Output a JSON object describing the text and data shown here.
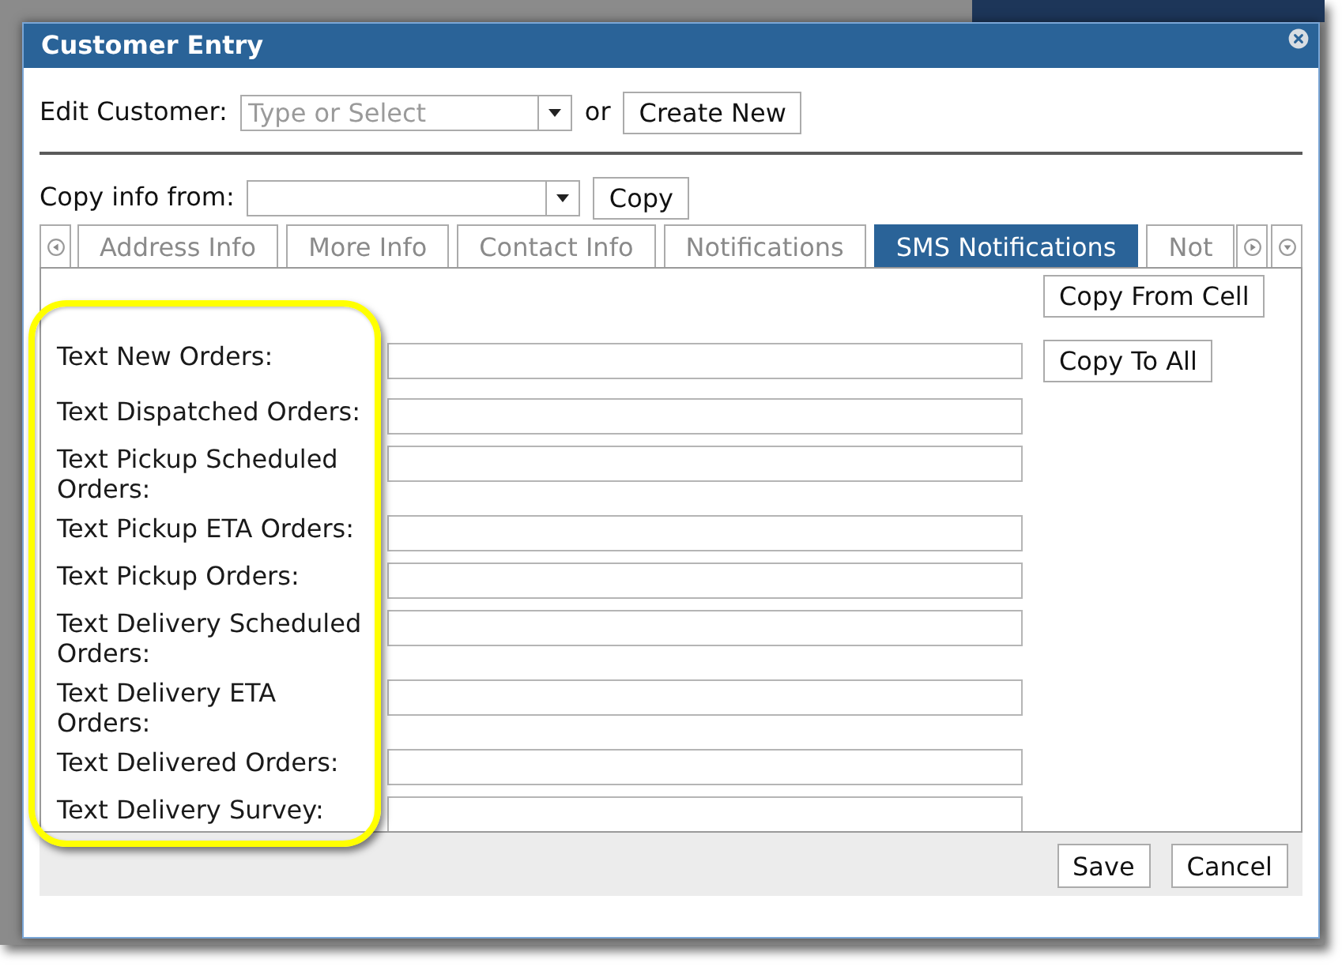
{
  "window": {
    "title": "Customer Entry"
  },
  "edit_customer": {
    "label": "Edit Customer:",
    "placeholder": "Type or Select",
    "separator": "or",
    "button": "Create New"
  },
  "copy_info": {
    "label": "Copy info from:",
    "button": "Copy"
  },
  "tabs": [
    {
      "label": "Address Info",
      "selected": false
    },
    {
      "label": "More Info",
      "selected": false
    },
    {
      "label": "Contact Info",
      "selected": false
    },
    {
      "label": "Notifications",
      "selected": false
    },
    {
      "label": "SMS Notifications",
      "selected": true
    },
    {
      "label": "Not",
      "selected": false
    }
  ],
  "side_buttons": [
    "Copy From Cell",
    "Copy To All"
  ],
  "fields": [
    {
      "label": "Text New Orders:"
    },
    {
      "label": "Text Dispatched Orders:"
    },
    {
      "label": "Text Pickup Scheduled Orders:"
    },
    {
      "label": "Text Pickup ETA Orders:"
    },
    {
      "label": "Text Pickup Orders:"
    },
    {
      "label": "Text Delivery Scheduled Orders:"
    },
    {
      "label": "Text Delivery ETA Orders:"
    },
    {
      "label": "Text Delivered Orders:"
    },
    {
      "label": "Text Delivery Survey:"
    }
  ],
  "footer_buttons": [
    "Save",
    "Cancel"
  ]
}
